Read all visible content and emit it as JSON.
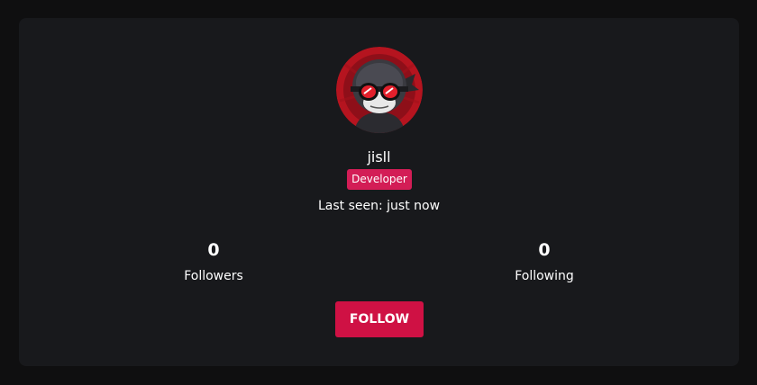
{
  "profile": {
    "username": "jisll",
    "role_badge": "Developer",
    "last_seen": "Last seen: just now",
    "avatar_icon": "ninja-with-red-goggles-avatar"
  },
  "stats": {
    "followers": {
      "count": "0",
      "label": "Followers"
    },
    "following": {
      "count": "0",
      "label": "Following"
    }
  },
  "actions": {
    "follow_label": "FOLLOW"
  },
  "colors": {
    "page_background": "#0f0f10",
    "card_background": "#18191c",
    "badge": "#d31d56",
    "follow_button": "#cf1144",
    "avatar_ring": "#b5141f"
  }
}
